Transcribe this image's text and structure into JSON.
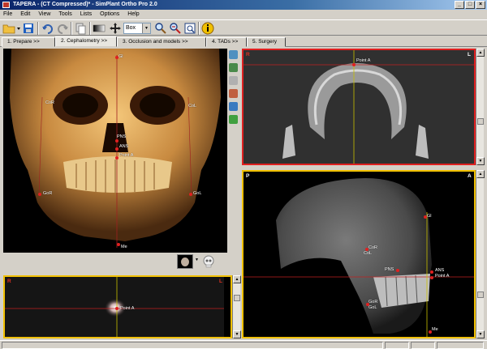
{
  "window": {
    "title": "TAPERA - (CT Compressed)* - SimPlant Ortho Pro  2.0",
    "min": "_",
    "max": "□",
    "close": "×"
  },
  "menu": [
    "File",
    "Edit",
    "View",
    "Tools",
    "Lists",
    "Options",
    "Help"
  ],
  "toolbar": {
    "combo_value": "Box",
    "combo_arrow": "▼",
    "icons": [
      "open-folder-icon",
      "save-icon",
      "undo-icon",
      "redo-icon",
      "copy-icon",
      "contrast-icon",
      "move-icon",
      "zoom-icon",
      "zoom-out-icon",
      "fit-window-icon",
      "info-icon"
    ]
  },
  "tabs": [
    {
      "label": "1. Prepare >>"
    },
    {
      "label": "2. Cephalometry >>"
    },
    {
      "label": "3. Occlusion and models >>"
    },
    {
      "label": "4. TADs >>"
    },
    {
      "label": "5. Surgery"
    }
  ],
  "views": {
    "render3d": {
      "landmarks": {
        "gl": "Gl",
        "cor": "CoR",
        "col": "CoL",
        "pns": "PNS",
        "ans": "ANS",
        "pointa": "Point A",
        "gor": "GoR",
        "gol": "GoL",
        "me": "Me"
      }
    },
    "axial_top": {
      "left": "R",
      "right": "L",
      "point": "Point A"
    },
    "axial_bottom": {
      "left": "R",
      "right": "L",
      "point": "Point A"
    },
    "sagittal": {
      "left": "P",
      "right": "A",
      "landmarks": {
        "gl": "Gl",
        "cor": "CoR",
        "col": "CoL",
        "pns": "PNS",
        "ans": "ANS",
        "pointa": "Point A",
        "gor": "GoR",
        "gol": "GoL",
        "me": "Me"
      }
    }
  },
  "colors": {
    "active_view_border": "#f0c000",
    "red_view_border": "#e02020",
    "landmark": "#e02020",
    "crosshair_red": "#c02020",
    "crosshair_yellow": "#c8c000"
  }
}
